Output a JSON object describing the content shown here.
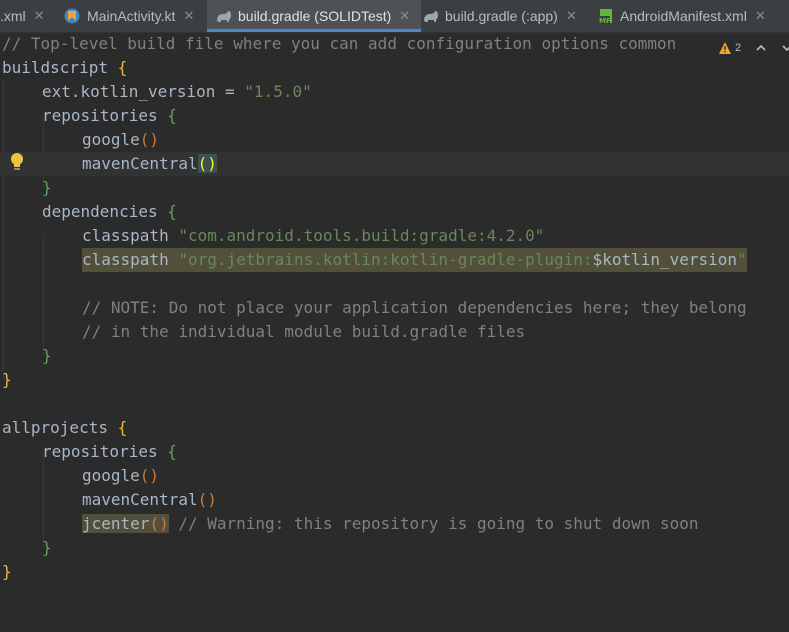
{
  "tabs": [
    {
      "label": ".xml",
      "icon": "xml-file-icon",
      "active": false
    },
    {
      "label": "MainActivity.kt",
      "icon": "kotlin-file-icon",
      "active": false
    },
    {
      "label": "build.gradle (SOLIDTest)",
      "icon": "gradle-elephant-icon",
      "active": true
    },
    {
      "label": "build.gradle (:app)",
      "icon": "gradle-elephant-icon",
      "active": false
    },
    {
      "label": "AndroidManifest.xml",
      "icon": "manifest-file-icon",
      "active": false
    }
  ],
  "inspection": {
    "warning_count": "2"
  },
  "code": {
    "l1": "// Top-level build file where you can add configuration options common",
    "l2_kw": "buildscript",
    "l3_prop": "ext.kotlin_version = ",
    "l3_str": "\"1.5.0\"",
    "repositories": "repositories",
    "google": "google",
    "mavenCentral": "mavenCentral",
    "dependencies": "dependencies",
    "classpath": "classpath",
    "cp1_str": "\"com.android.tools.build:gradle:4.2.0\"",
    "cp2_str": "\"org.jetbrains.kotlin:kotlin-gradle-plugin:",
    "cp2_var": "$kotlin_version",
    "cp2_end": "\"",
    "note1": "// NOTE: Do not place your application dependencies here; they belong",
    "note2": "// in the individual module build.gradle files",
    "allprojects": "allprojects",
    "jcenter": "jcenter",
    "jcenter_cmt": "// Warning: this repository is going to shut down soon",
    "open_brace": "{",
    "close_brace": "}",
    "parens": "()",
    "space": " "
  },
  "colors": {
    "background": "#2b2b2b",
    "comment": "#808080",
    "string": "#6a8759",
    "text": "#a9b7c6",
    "active_tab_underline": "#4a88c7"
  }
}
